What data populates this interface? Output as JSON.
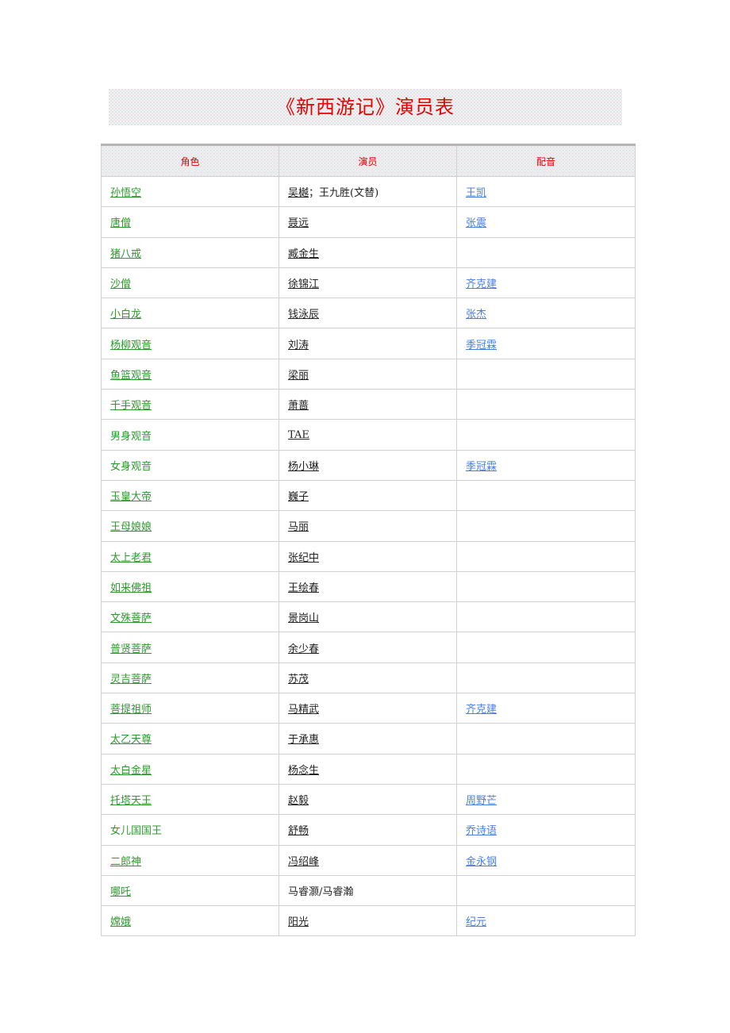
{
  "title": "《新西游记》演员表",
  "colors": {
    "title": "#e60000",
    "header_text": "#e60000",
    "role_link": "#2e9a2e",
    "actor_text": "#222222",
    "voice_link": "#4a7fe0",
    "border": "#d0d0d0"
  },
  "table": {
    "headers": [
      "角色",
      "演员",
      "配音"
    ],
    "rows": [
      {
        "role": "孙悟空",
        "role_linked": true,
        "actor": "吴樾；王九胜(文替)",
        "actor_linked": "partial",
        "actor_link_part": "吴樾",
        "actor_rest": "；王九胜(文替)",
        "voice": "王凯"
      },
      {
        "role": "唐僧",
        "role_linked": true,
        "actor": "聂远",
        "actor_linked": true,
        "voice": "张震"
      },
      {
        "role": "猪八戒",
        "role_linked": true,
        "actor": "臧金生",
        "actor_linked": true,
        "voice": ""
      },
      {
        "role": "沙僧",
        "role_linked": true,
        "actor": "徐锦江",
        "actor_linked": true,
        "voice": "齐克建"
      },
      {
        "role": "小白龙",
        "role_linked": true,
        "actor": "钱泳辰",
        "actor_linked": true,
        "voice": "张杰"
      },
      {
        "role": "杨柳观音",
        "role_linked": true,
        "actor": "刘涛",
        "actor_linked": true,
        "voice": "季冠霖"
      },
      {
        "role": "鱼篮观音",
        "role_linked": true,
        "actor": "梁丽",
        "actor_linked": true,
        "voice": ""
      },
      {
        "role": "千手观音",
        "role_linked": true,
        "actor": "萧蔷",
        "actor_linked": true,
        "voice": ""
      },
      {
        "role": "男身观音",
        "role_linked": false,
        "actor": "TAE",
        "actor_linked": true,
        "voice": ""
      },
      {
        "role": "女身观音",
        "role_linked": false,
        "actor": "杨小琳",
        "actor_linked": true,
        "voice": "季冠霖"
      },
      {
        "role": "玉皇大帝",
        "role_linked": true,
        "actor": "巍子",
        "actor_linked": true,
        "voice": ""
      },
      {
        "role": "王母娘娘",
        "role_linked": true,
        "actor": "马丽",
        "actor_linked": true,
        "voice": ""
      },
      {
        "role": "太上老君",
        "role_linked": true,
        "actor": "张纪中",
        "actor_linked": true,
        "voice": ""
      },
      {
        "role": "如来佛祖",
        "role_linked": true,
        "actor": "王绘春",
        "actor_linked": true,
        "voice": ""
      },
      {
        "role": "文殊菩萨",
        "role_linked": true,
        "actor": "景岗山",
        "actor_linked": true,
        "voice": ""
      },
      {
        "role": "普贤菩萨",
        "role_linked": true,
        "actor": "余少春",
        "actor_linked": true,
        "voice": ""
      },
      {
        "role": "灵吉菩萨",
        "role_linked": true,
        "actor": "苏茂",
        "actor_linked": true,
        "voice": ""
      },
      {
        "role": "菩提祖师",
        "role_linked": true,
        "actor": "马精武",
        "actor_linked": true,
        "voice": "齐克建"
      },
      {
        "role": "太乙天尊",
        "role_linked": true,
        "actor": "于承惠",
        "actor_linked": true,
        "voice": ""
      },
      {
        "role": "太白金星",
        "role_linked": true,
        "actor": "杨念生",
        "actor_linked": true,
        "voice": ""
      },
      {
        "role": "托塔天王",
        "role_linked": true,
        "actor": "赵毅",
        "actor_linked": true,
        "voice": "周野芒"
      },
      {
        "role": "女儿国国王",
        "role_linked": false,
        "actor": "舒畅",
        "actor_linked": true,
        "voice": "乔诗语"
      },
      {
        "role": "二郎神",
        "role_linked": true,
        "actor": "冯绍峰",
        "actor_linked": true,
        "voice": "金永钢"
      },
      {
        "role": "哪吒",
        "role_linked": true,
        "actor": "马睿灏/马睿瀚",
        "actor_linked": false,
        "voice": ""
      },
      {
        "role": "嫦娥",
        "role_linked": true,
        "actor": "阳光",
        "actor_linked": true,
        "voice": "纪元"
      }
    ]
  }
}
